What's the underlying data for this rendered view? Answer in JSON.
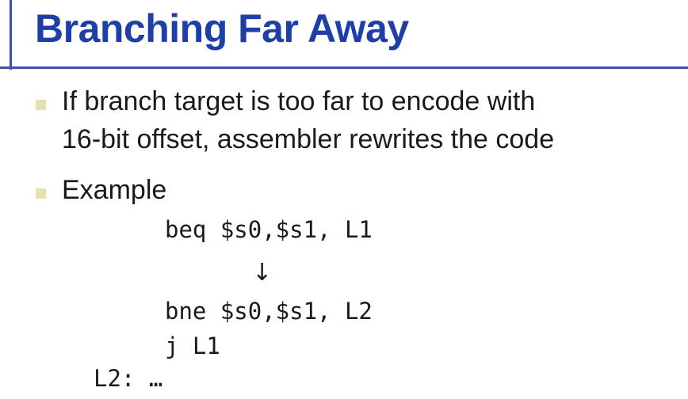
{
  "slide": {
    "title": "Branching Far Away",
    "bullets": [
      {
        "lines": [
          "If branch target is too far to encode with",
          "16-bit offset, assembler rewrites the code"
        ]
      },
      {
        "lines": [
          "Example"
        ]
      }
    ],
    "code": {
      "line1": "beq $s0,$s1, L1",
      "arrow": "↓",
      "line2": "bne $s0,$s1, L2",
      "line3": "j L1",
      "line4": "L2: …"
    }
  },
  "colors": {
    "title": "#1f3fa8",
    "rule": "#3a55a8",
    "bullet": "#e7e1b1",
    "text": "#1a1a1a"
  }
}
